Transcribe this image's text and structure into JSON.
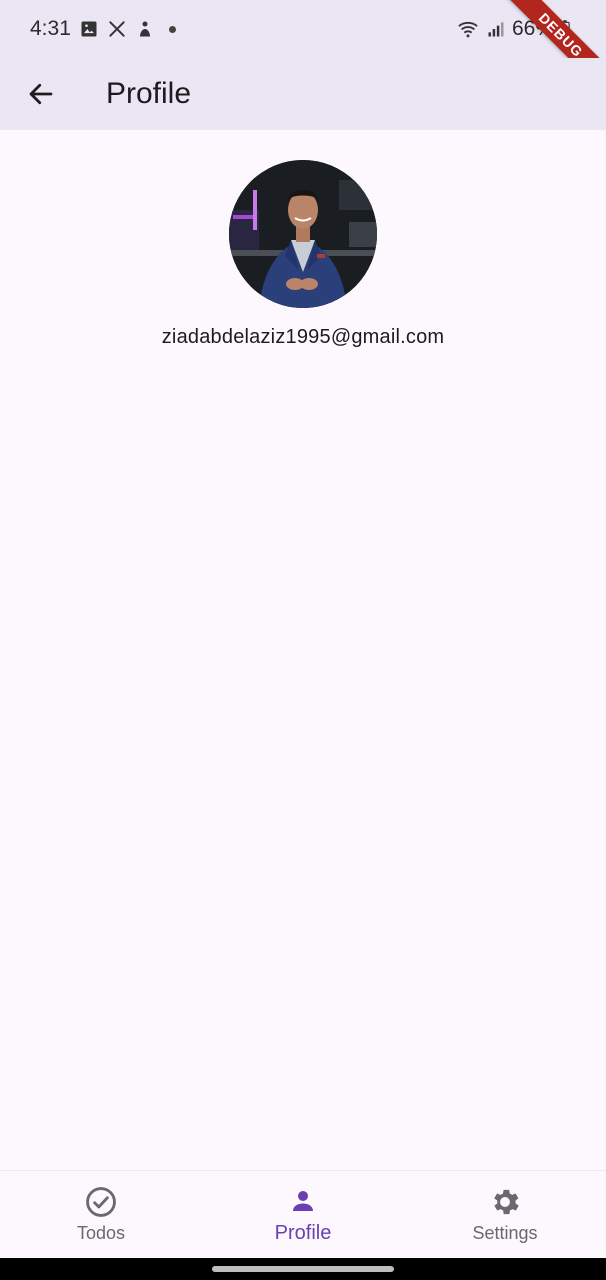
{
  "status_bar": {
    "time": "4:31",
    "battery": "66%",
    "icons": [
      "image-icon",
      "tools-icon",
      "figure-icon",
      "dot-icon",
      "wifi-icon",
      "signal-icon",
      "battery-icon"
    ]
  },
  "debug_banner": {
    "label": "DEBUG"
  },
  "app_bar": {
    "back_icon": "arrow-left-icon",
    "title": "Profile"
  },
  "profile": {
    "email": "ziadabdelaziz1995@gmail.com"
  },
  "bottom_nav": {
    "items": [
      {
        "label": "Todos",
        "icon": "check-circle-icon",
        "active": false
      },
      {
        "label": "Profile",
        "icon": "person-icon",
        "active": true
      },
      {
        "label": "Settings",
        "icon": "gear-icon",
        "active": false
      }
    ]
  },
  "colors": {
    "app_bar_bg": "#ebe6f4",
    "accent": "#6a3fb3",
    "inactive": "#6b6770",
    "debug_red": "#b3261e"
  }
}
